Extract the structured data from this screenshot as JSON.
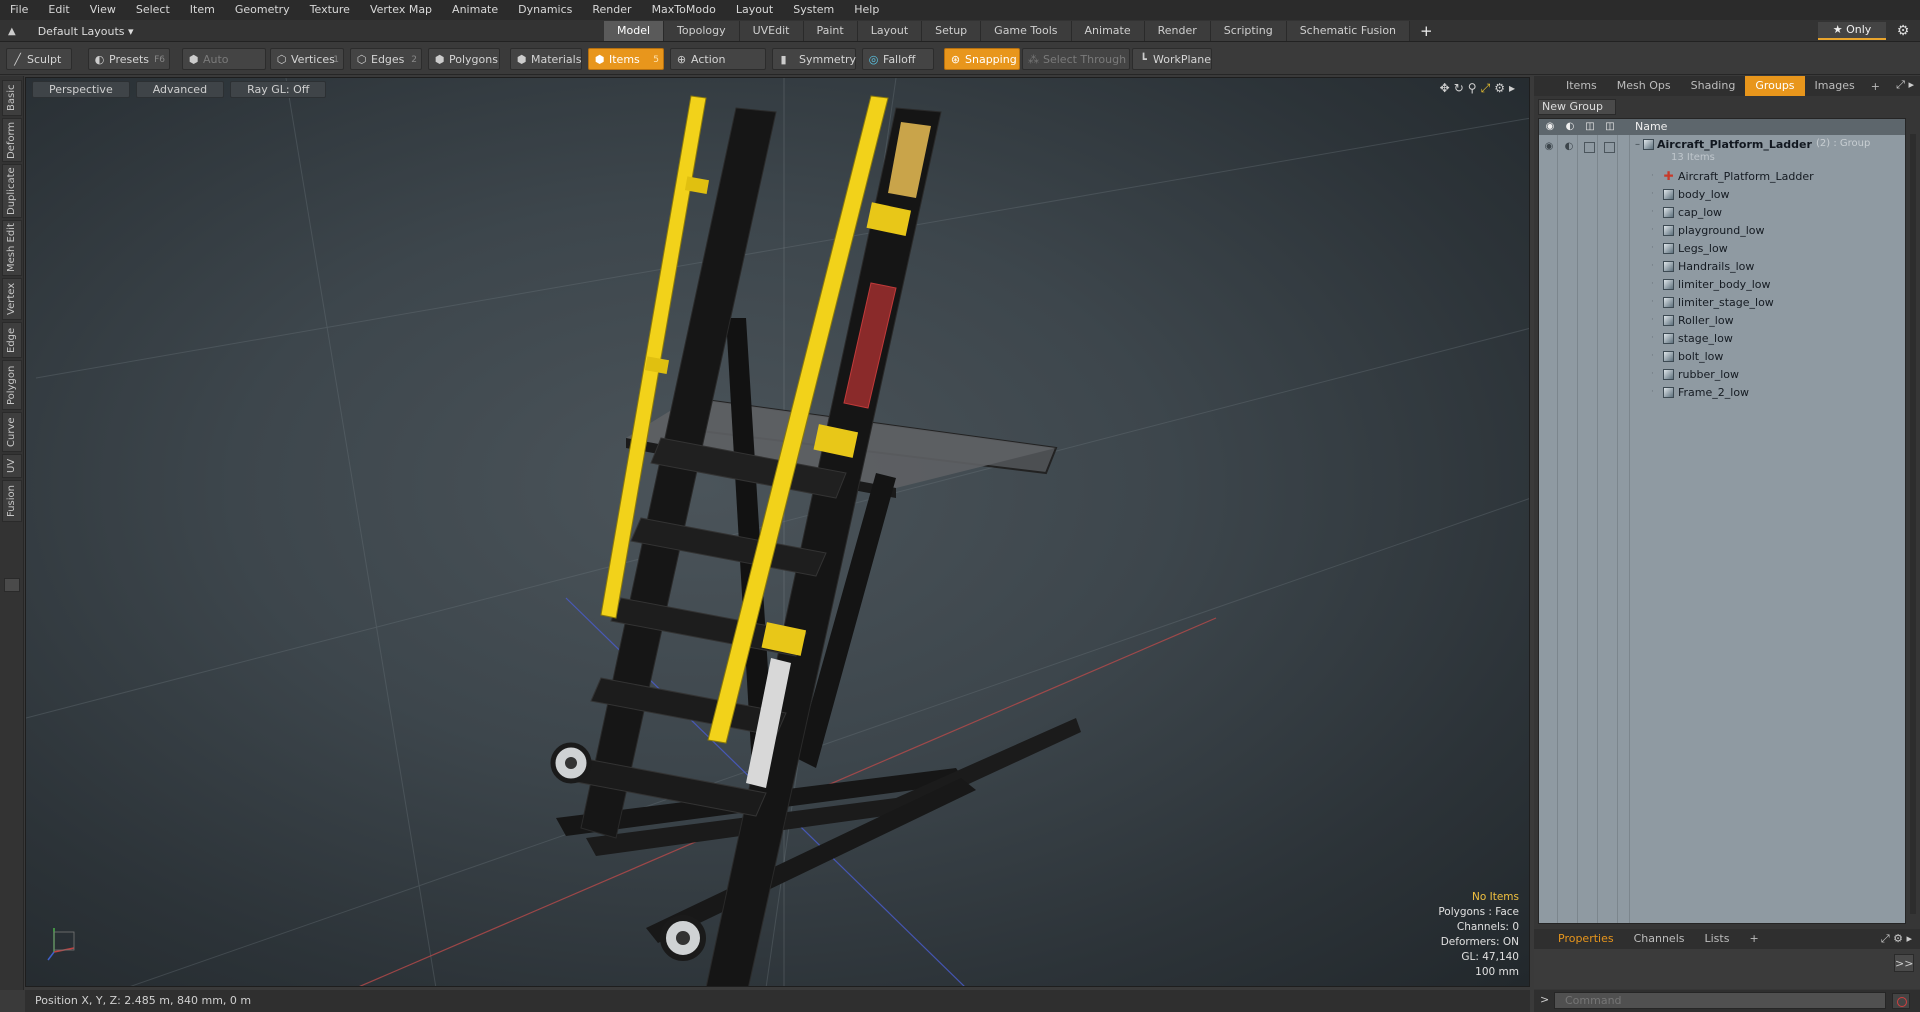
{
  "menu": [
    "File",
    "Edit",
    "View",
    "Select",
    "Item",
    "Geometry",
    "Texture",
    "Vertex Map",
    "Animate",
    "Dynamics",
    "Render",
    "MaxToModo",
    "Layout",
    "System",
    "Help"
  ],
  "layout_selector": "Default Layouts ▾",
  "mode_tabs": [
    "Model",
    "Topology",
    "UVEdit",
    "Paint",
    "Layout",
    "Setup",
    "Game Tools",
    "Animate",
    "Render",
    "Scripting",
    "Schematic Fusion"
  ],
  "active_mode_tab": "Model",
  "only_button": "★  Only",
  "toolbar": {
    "sculpt": "Sculpt",
    "presets": "Presets",
    "presets_key": "F6",
    "auto_select": "Auto Select",
    "vertices": "Vertices",
    "vertices_key": "1",
    "edges": "Edges",
    "edges_key": "2",
    "polygons": "Polygons",
    "materials": "Materials",
    "items": "Items",
    "items_key": "5",
    "action_center": "Action Center",
    "symmetry": "Symmetry",
    "falloff": "Falloff",
    "snapping": "Snapping",
    "select_through": "Select Through",
    "workplane": "WorkPlane"
  },
  "left_tabs": [
    "Basic",
    "Deform",
    "Duplicate",
    "Mesh Edit",
    "Vertex",
    "Edge",
    "Polygon",
    "Curve",
    "UV",
    "Fusion"
  ],
  "viewport": {
    "view": "Perspective",
    "shading": "Advanced",
    "raygl": "Ray GL: Off",
    "info": {
      "items": "No Items",
      "polygons": "Polygons : Face",
      "channels": "Channels: 0",
      "deformers": "Deformers: ON",
      "gl": "GL: 47,140",
      "scale": "100 mm"
    }
  },
  "status_bar": "Position X, Y, Z:  2.485 m, 840 mm, 0 m",
  "right_panel": {
    "tabs": [
      "Items",
      "Mesh Ops",
      "Shading",
      "Groups",
      "Images"
    ],
    "active_tab": "Groups",
    "new_group": "New Group",
    "column_name": "Name",
    "group": {
      "name": "Aircraft_Platform_Ladder",
      "suffix": "(2) : Group",
      "count": "13 Items"
    },
    "items": [
      "Aircraft_Platform_Ladder",
      "body_low",
      "cap_low",
      "playground_low",
      "Legs_low",
      "Handrails_low",
      "limiter_body_low",
      "limiter_stage_low",
      "Roller_low",
      "stage_low",
      "bolt_low",
      "rubber_low",
      "Frame_2_low"
    ]
  },
  "bottom_tabs": [
    "Properties",
    "Channels",
    "Lists"
  ],
  "active_bottom_tab": "Properties",
  "command_placeholder": "Command",
  "colors": {
    "accent": "#e8961c",
    "handrail": "#f2d21a",
    "frame": "#141414",
    "list_bg": "#8f9aa2"
  }
}
